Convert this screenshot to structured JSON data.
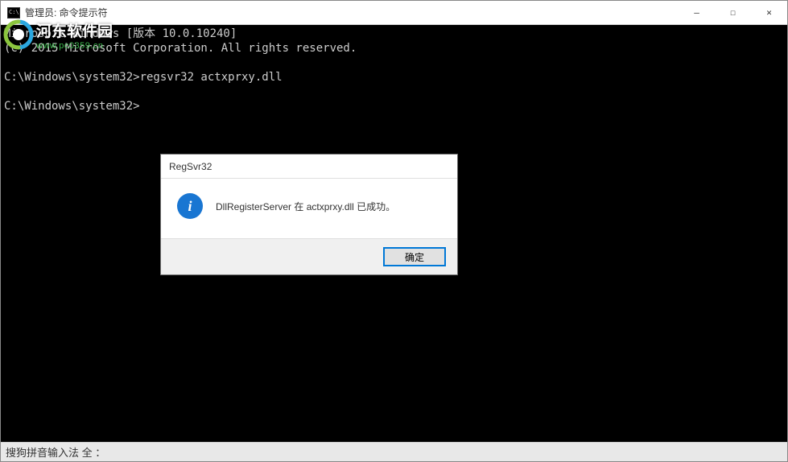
{
  "titlebar": {
    "text": "管理员: 命令提示符"
  },
  "window_controls": {
    "minimize": "—",
    "maximize": "☐",
    "close": "✕"
  },
  "terminal": {
    "line1": "Microsoft Windows [版本 10.0.10240]",
    "line2": "(c) 2015 Microsoft Corporation. All rights reserved.",
    "line3": "",
    "line4": "C:\\Windows\\system32>regsvr32 actxprxy.dll",
    "line5": "",
    "line6": "C:\\Windows\\system32>"
  },
  "watermark": {
    "cn_text": "河东软件园",
    "url_text": "www.pc0359.cn"
  },
  "dialog": {
    "title": "RegSvr32",
    "message": "DllRegisterServer 在 actxprxy.dll 已成功。",
    "ok_button": "确定",
    "info_char": "i"
  },
  "ime": {
    "text": "搜狗拼音输入法 全 ："
  }
}
